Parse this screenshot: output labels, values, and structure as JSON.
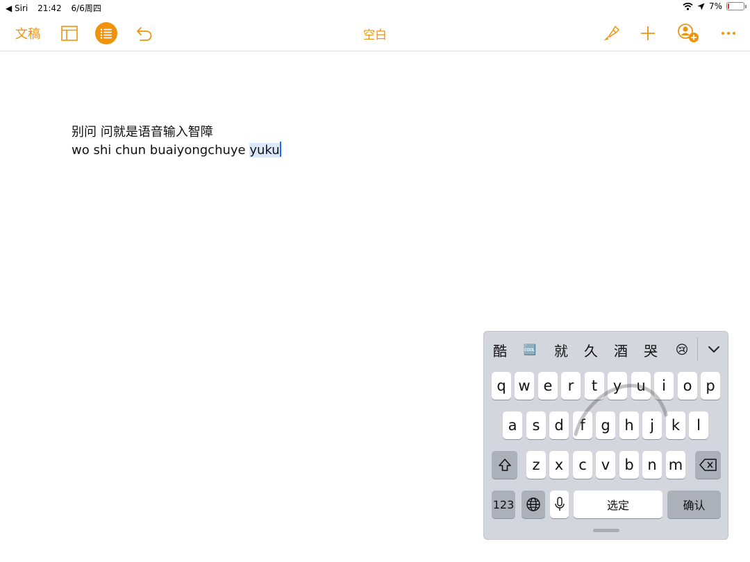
{
  "status_bar": {
    "back_app": "◀ Siri",
    "time": "21:42",
    "date": "6/6周四",
    "battery_percent": "7%",
    "battery_level": 0.07
  },
  "toolbar": {
    "docs_label": "文稿",
    "title": "空白",
    "accent_color": "#f0920a"
  },
  "document": {
    "line1": "别问 问就是语音输入智障",
    "line2_committed": "wo shi chun buaiyongchuye ",
    "line2_marked": "yuku"
  },
  "keyboard": {
    "candidates": [
      "酷",
      "🆒",
      "就",
      "久",
      "酒",
      "哭",
      "😢"
    ],
    "rows": [
      [
        "q",
        "w",
        "e",
        "r",
        "t",
        "y",
        "u",
        "i",
        "o",
        "p"
      ],
      [
        "a",
        "s",
        "d",
        "f",
        "g",
        "h",
        "j",
        "k",
        "l"
      ],
      [
        "z",
        "x",
        "c",
        "v",
        "b",
        "n",
        "m"
      ]
    ],
    "numbers_label": "123",
    "space_label": "选定",
    "return_label": "确认"
  }
}
